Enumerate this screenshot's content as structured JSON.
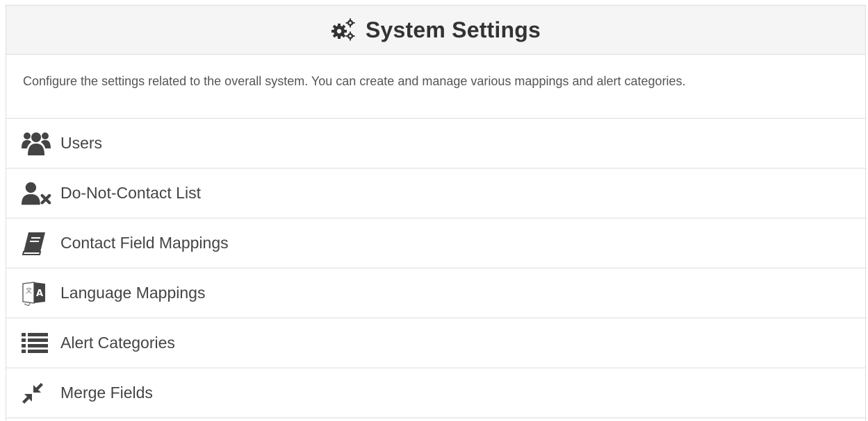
{
  "header": {
    "title": "System Settings",
    "icon": "gears-icon"
  },
  "description": "Configure the settings related to the overall system. You can create and manage various mappings and alert categories.",
  "items": [
    {
      "label": "Users",
      "icon": "users-icon"
    },
    {
      "label": "Do-Not-Contact List",
      "icon": "user-times-icon"
    },
    {
      "label": "Contact Field Mappings",
      "icon": "book-icon"
    },
    {
      "label": "Language Mappings",
      "icon": "language-icon"
    },
    {
      "label": "Alert Categories",
      "icon": "list-icon"
    },
    {
      "label": "Merge Fields",
      "icon": "compress-icon"
    }
  ],
  "colors": {
    "heading_bg": "#f5f5f5",
    "border": "#dddddd",
    "text": "#333333",
    "icon": "#444444"
  }
}
